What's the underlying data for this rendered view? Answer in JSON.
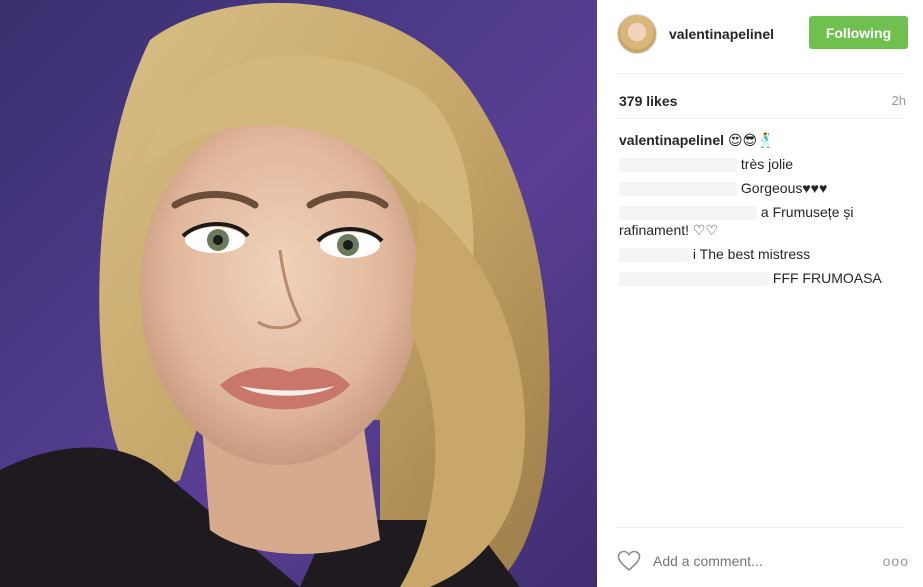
{
  "post": {
    "username": "valentinapelinel",
    "follow_label": "Following",
    "likes": "379 likes",
    "time": "2h",
    "caption_user": "valentinapelinel",
    "caption_text": "😍😎🕺",
    "comments": [
      {
        "user": "",
        "text": "très jolie"
      },
      {
        "user": "",
        "text": "Gorgeous♥♥♥"
      },
      {
        "user": "",
        "text": "a Frumusețe și rafinament! ♡♡"
      },
      {
        "user": "",
        "text": "i The best mistress"
      },
      {
        "user": "",
        "text": "FFF FRUMOASA"
      }
    ],
    "add_comment_placeholder": "Add a comment...",
    "more_label": "ooo"
  },
  "icons": {
    "like": "heart-outline-icon",
    "more": "more-options-icon"
  },
  "colors": {
    "follow_button": "#70c050",
    "photo_background": "#4b3a87"
  }
}
